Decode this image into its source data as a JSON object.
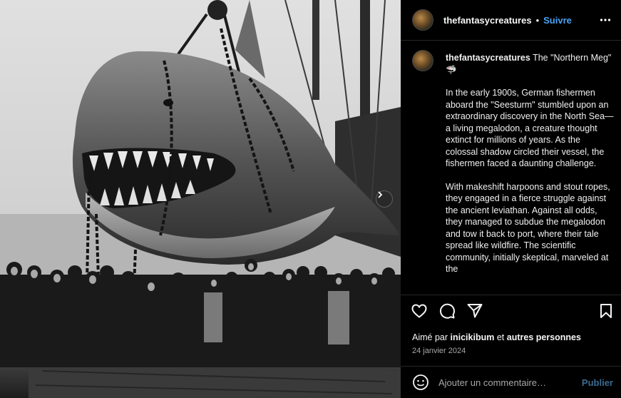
{
  "post": {
    "image_alt": "",
    "next_icon": "chevron-right-icon"
  },
  "header": {
    "username": "thefantasycreatures",
    "separator": "•",
    "follow_label": "Suivre",
    "more_icon": "more-horizontal-icon"
  },
  "caption": {
    "username": "thefantasycreatures",
    "title": "The \"Northern Meg\" 🦈",
    "paragraphs": [
      "In the early 1900s, German fishermen aboard the \"Seesturm\" stumbled upon an extraordinary discovery in the North Sea—a living megalodon, a creature thought extinct for millions of years. As the colossal shadow circled their vessel, the fishermen faced a daunting challenge.",
      "With makeshift harpoons and stout ropes, they engaged in a fierce struggle against the ancient leviathan. Against all odds, they managed to subdue the megalodon and tow it back to port, where their tale spread like wildfire. The scientific community, initially skeptical, marveled at the"
    ]
  },
  "actions": {
    "like_icon": "heart-icon",
    "comment_icon": "comment-icon",
    "share_icon": "send-icon",
    "save_icon": "bookmark-icon"
  },
  "likes": {
    "prefix": "Aimé par",
    "user": "inicikibum",
    "connector": "et",
    "others": "autres personnes"
  },
  "date": "24 janvier 2024",
  "comment": {
    "placeholder": "Ajouter un commentaire…",
    "publish_label": "Publier",
    "emoji_icon": "emoji-icon"
  },
  "colors": {
    "accent": "#4aa3f5",
    "publish_disabled": "#3b6a8f",
    "divider": "#262626",
    "secondary_text": "#a8a8a8"
  }
}
